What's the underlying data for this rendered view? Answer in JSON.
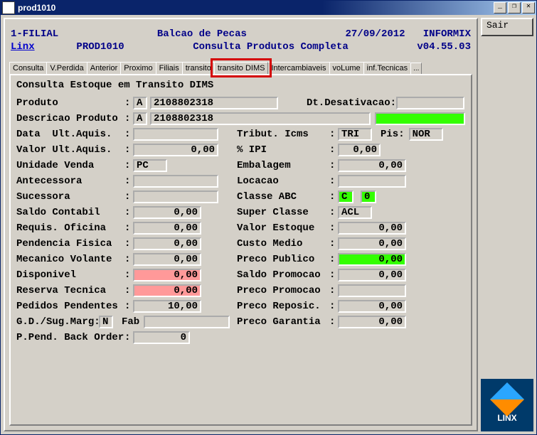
{
  "window": {
    "title": "prod1010",
    "minimize": "_",
    "restore": "❐",
    "close": "✕"
  },
  "side": {
    "sair_label": "Sair",
    "logo_text": "LINX"
  },
  "header": {
    "line1_left": "1-FILIAL",
    "line1_center": "Balcao de Pecas",
    "line1_date": "27/09/2012",
    "line1_right": "INFORMIX",
    "line2_link": "Linx",
    "line2_code": "PROD1010",
    "line2_center": "Consulta Produtos Completa",
    "line2_version": "v04.55.03"
  },
  "tabs": {
    "items": [
      "Consulta",
      "V.Perdida",
      "Anterior",
      "Proximo",
      "Filiais",
      "transito",
      "transito DIMS",
      "Intercambiaveis",
      "voLume",
      "inf.Tecnicas",
      "..."
    ],
    "highlighted_index": 6
  },
  "form": {
    "title": "Consulta Estoque em Transito DIMS",
    "left": {
      "produto_label": "Produto",
      "produto_code": "A",
      "produto_value": "2108802318",
      "descricao_label": "Descricao Produto",
      "descricao_code": "A",
      "descricao_value": "2108802318",
      "data_ult_aquis_label": "Data  Ult.Aquis.",
      "data_ult_aquis_value": "",
      "valor_ult_aquis_label": "Valor Ult.Aquis.",
      "valor_ult_aquis_value": "0,00",
      "unidade_venda_label": "Unidade Venda",
      "unidade_venda_value": "PC",
      "antecessora_label": "Antecessora",
      "antecessora_value": "",
      "sucessora_label": "Sucessora",
      "sucessora_value": "",
      "saldo_contabil_label": "Saldo Contabil",
      "saldo_contabil_value": "0,00",
      "requis_oficina_label": "Requis. Oficina",
      "requis_oficina_value": "0,00",
      "pendencia_fisica_label": "Pendencia Fisica",
      "pendencia_fisica_value": "0,00",
      "mecanico_volante_label": "Mecanico Volante",
      "mecanico_volante_value": "0,00",
      "disponivel_label": "Disponivel",
      "disponivel_value": "0,00",
      "reserva_tecnica_label": "Reserva Tecnica",
      "reserva_tecnica_value": "0,00",
      "pedidos_pendentes_label": "Pedidos Pendentes",
      "pedidos_pendentes_value": "10,00"
    },
    "right": {
      "dt_desativacao_label": "Dt.Desativacao",
      "dt_desativacao_value": "",
      "blank_green_value": "",
      "tribut_icms_label": "Tribut. Icms",
      "tribut_icms_value": "TRI",
      "pis_label": "Pis:",
      "pis_value": "NOR",
      "pct_ipi_label": "% IPI",
      "pct_ipi_value": "0,00",
      "embalagem_label": "Embalagem",
      "embalagem_value": "0,00",
      "locacao_label": "Locacao",
      "locacao_value": "",
      "classe_abc_label": "Classe ABC",
      "classe_abc_value1": "C",
      "classe_abc_value2": "0",
      "super_classe_label": "Super Classe",
      "super_classe_value": "ACL",
      "valor_estoque_label": "Valor Estoque",
      "valor_estoque_value": "0,00",
      "custo_medio_label": "Custo Medio",
      "custo_medio_value": "0,00",
      "preco_publico_label": "Preco Publico",
      "preco_publico_value": "0,00",
      "saldo_promocao_label": "Saldo Promocao",
      "saldo_promocao_value": "0,00",
      "preco_promocao_label": "Preco Promocao",
      "preco_promocao_value": "",
      "preco_reposic_label": "Preco Reposic.",
      "preco_reposic_value": "0,00",
      "preco_garantia_label": "Preco Garantia",
      "preco_garantia_value": "0,00"
    },
    "bottom": {
      "gd_sug_label": "G.D./Sug.Marg:",
      "gd_sug_value": "N",
      "fab_label": "Fab",
      "fab_value": "",
      "p_pend_label": "P.Pend. Back Order",
      "p_pend_value": "0"
    }
  }
}
